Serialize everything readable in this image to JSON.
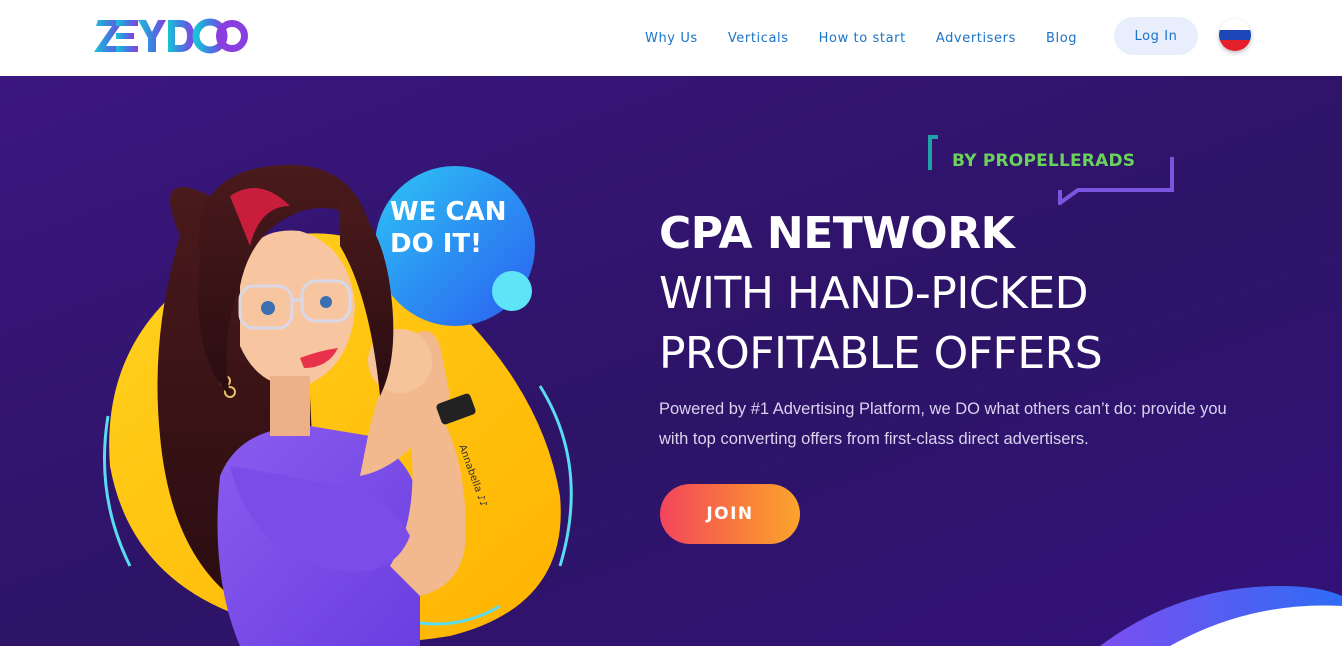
{
  "header": {
    "logo_text": "ZEYDOO",
    "nav": [
      {
        "label": "Why Us"
      },
      {
        "label": "Verticals"
      },
      {
        "label": "How to start"
      },
      {
        "label": "Advertisers"
      },
      {
        "label": "Blog"
      }
    ],
    "login_label": "Log In",
    "language_flag_icon": "russian-flag-icon"
  },
  "hero": {
    "badge": "BY PROPELLERADS",
    "title_line1": "CPA NETWORK",
    "title_line2": "WITH HAND-PICKED",
    "title_line3": "PROFITABLE OFFERS",
    "description": "Powered by #1 Advertising Platform, we DO what others can’t do: provide you with top converting offers from first-class direct advertisers.",
    "join_label": "JOIN",
    "illustration_bubble_text_line1": "WE CAN",
    "illustration_bubble_text_line2": "DO IT!",
    "illustration_wrist_text": "Annabella ♪♪"
  },
  "colors": {
    "nav_text": "#1b73c8",
    "hero_bg": "#2d1466",
    "badge_text": "#6ad15a",
    "join_gradient_start": "#f2455c",
    "join_gradient_end": "#fba42e"
  }
}
